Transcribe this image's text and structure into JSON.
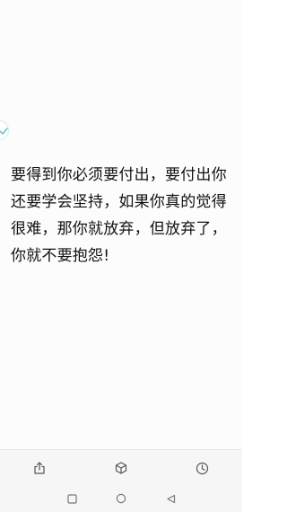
{
  "content": {
    "lines": [
      "要得到你必须要付出，要付出你",
      "还要学会坚持，如果你真的觉得",
      "很难，那你就放弃，但放弃了，",
      "你就不要抱怨!"
    ]
  },
  "toolbar": {
    "items": [
      {
        "icon": "share-icon"
      },
      {
        "icon": "cube-icon"
      },
      {
        "icon": "clock-icon"
      }
    ]
  },
  "navbar": {
    "items": [
      {
        "icon": "recent-apps-icon"
      },
      {
        "icon": "home-icon"
      },
      {
        "icon": "back-icon"
      }
    ]
  },
  "colors": {
    "text": "#111111",
    "icon": "#555555",
    "badge_border": "#cdeee7",
    "badge_check": "#4fc3c0"
  }
}
